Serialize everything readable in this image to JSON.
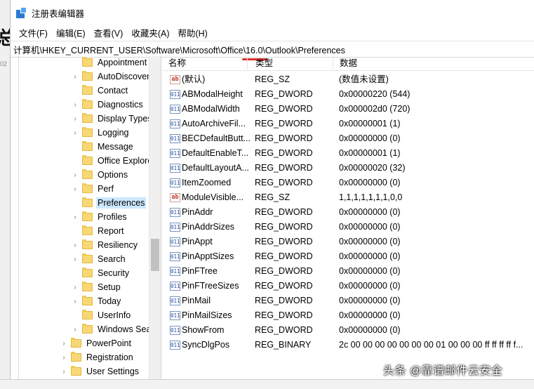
{
  "background": {
    "fragment_char": "总",
    "fragment_text": "02"
  },
  "window": {
    "title": "注册表编辑器",
    "icon": "regedit-icon"
  },
  "menu": [
    "文件(F)",
    "编辑(E)",
    "查看(V)",
    "收藏夹(A)",
    "帮助(H)"
  ],
  "address": {
    "path": "计算机\\HKEY_CURRENT_USER\\Software\\Microsoft\\Office\\16.0\\Outlook\\Preferences"
  },
  "tree": {
    "items": [
      {
        "label": "Appointment",
        "level": 2,
        "expander": false
      },
      {
        "label": "AutoDiscover",
        "level": 2,
        "expander": true
      },
      {
        "label": "Contact",
        "level": 2,
        "expander": false
      },
      {
        "label": "Diagnostics",
        "level": 2,
        "expander": true
      },
      {
        "label": "Display Types",
        "level": 2,
        "expander": true
      },
      {
        "label": "Logging",
        "level": 2,
        "expander": true
      },
      {
        "label": "Message",
        "level": 2,
        "expander": false
      },
      {
        "label": "Office Explore",
        "level": 2,
        "expander": false
      },
      {
        "label": "Options",
        "level": 2,
        "expander": true
      },
      {
        "label": "Perf",
        "level": 2,
        "expander": true
      },
      {
        "label": "Preferences",
        "level": 2,
        "expander": false,
        "selected": true
      },
      {
        "label": "Profiles",
        "level": 2,
        "expander": true
      },
      {
        "label": "Report",
        "level": 2,
        "expander": false
      },
      {
        "label": "Resiliency",
        "level": 2,
        "expander": true
      },
      {
        "label": "Search",
        "level": 2,
        "expander": true
      },
      {
        "label": "Security",
        "level": 2,
        "expander": false
      },
      {
        "label": "Setup",
        "level": 2,
        "expander": true
      },
      {
        "label": "Today",
        "level": 2,
        "expander": true
      },
      {
        "label": "UserInfo",
        "level": 2,
        "expander": false
      },
      {
        "label": "Windows Sea",
        "level": 2,
        "expander": true
      },
      {
        "label": "PowerPoint",
        "level": 1,
        "expander": true
      },
      {
        "label": "Registration",
        "level": 1,
        "expander": true
      },
      {
        "label": "User Settings",
        "level": 1,
        "expander": true
      }
    ]
  },
  "values": {
    "headers": {
      "name": "名称",
      "type": "类型",
      "data": "数据"
    },
    "rows": [
      {
        "icon": "string-value-icon",
        "glyph": "ab",
        "name": "(默认)",
        "type": "REG_SZ",
        "data": "(数值未设置)"
      },
      {
        "icon": "binary-value-icon",
        "glyph": "011",
        "name": "ABModalHeight",
        "type": "REG_DWORD",
        "data": "0x00000220 (544)"
      },
      {
        "icon": "binary-value-icon",
        "glyph": "011",
        "name": "ABModalWidth",
        "type": "REG_DWORD",
        "data": "0x000002d0 (720)"
      },
      {
        "icon": "binary-value-icon",
        "glyph": "011",
        "name": "AutoArchiveFil...",
        "type": "REG_DWORD",
        "data": "0x00000001 (1)"
      },
      {
        "icon": "binary-value-icon",
        "glyph": "011",
        "name": "BECDefaultButt...",
        "type": "REG_DWORD",
        "data": "0x00000000 (0)"
      },
      {
        "icon": "binary-value-icon",
        "glyph": "011",
        "name": "DefaultEnableT...",
        "type": "REG_DWORD",
        "data": "0x00000001 (1)"
      },
      {
        "icon": "binary-value-icon",
        "glyph": "011",
        "name": "DefaultLayoutA...",
        "type": "REG_DWORD",
        "data": "0x00000020 (32)"
      },
      {
        "icon": "binary-value-icon",
        "glyph": "011",
        "name": "ItemZoomed",
        "type": "REG_DWORD",
        "data": "0x00000000 (0)"
      },
      {
        "icon": "string-value-icon",
        "glyph": "ab",
        "name": "ModuleVisible...",
        "type": "REG_SZ",
        "data": "1,1,1,1,1,1,1,0,0"
      },
      {
        "icon": "binary-value-icon",
        "glyph": "011",
        "name": "PinAddr",
        "type": "REG_DWORD",
        "data": "0x00000000 (0)"
      },
      {
        "icon": "binary-value-icon",
        "glyph": "011",
        "name": "PinAddrSizes",
        "type": "REG_DWORD",
        "data": "0x00000000 (0)"
      },
      {
        "icon": "binary-value-icon",
        "glyph": "011",
        "name": "PinAppt",
        "type": "REG_DWORD",
        "data": "0x00000000 (0)"
      },
      {
        "icon": "binary-value-icon",
        "glyph": "011",
        "name": "PinApptSizes",
        "type": "REG_DWORD",
        "data": "0x00000000 (0)"
      },
      {
        "icon": "binary-value-icon",
        "glyph": "011",
        "name": "PinFTree",
        "type": "REG_DWORD",
        "data": "0x00000000 (0)"
      },
      {
        "icon": "binary-value-icon",
        "glyph": "011",
        "name": "PinFTreeSizes",
        "type": "REG_DWORD",
        "data": "0x00000000 (0)"
      },
      {
        "icon": "binary-value-icon",
        "glyph": "011",
        "name": "PinMail",
        "type": "REG_DWORD",
        "data": "0x00000000 (0)"
      },
      {
        "icon": "binary-value-icon",
        "glyph": "011",
        "name": "PinMailSizes",
        "type": "REG_DWORD",
        "data": "0x00000000 (0)"
      },
      {
        "icon": "binary-value-icon",
        "glyph": "011",
        "name": "ShowFrom",
        "type": "REG_DWORD",
        "data": "0x00000000 (0)"
      },
      {
        "icon": "binary-value-icon",
        "glyph": "011",
        "name": "SyncDlgPos",
        "type": "REG_BINARY",
        "data": "2c 00 00 00 00 00 00 00 01 00 00 00 ff ff ff ff f..."
      }
    ]
  },
  "colors": {
    "selection": "#cce8ff",
    "folder": "#f8d775",
    "accent_mark": "#e0312e"
  },
  "watermark": "头条 @靠谱邮件云安全"
}
